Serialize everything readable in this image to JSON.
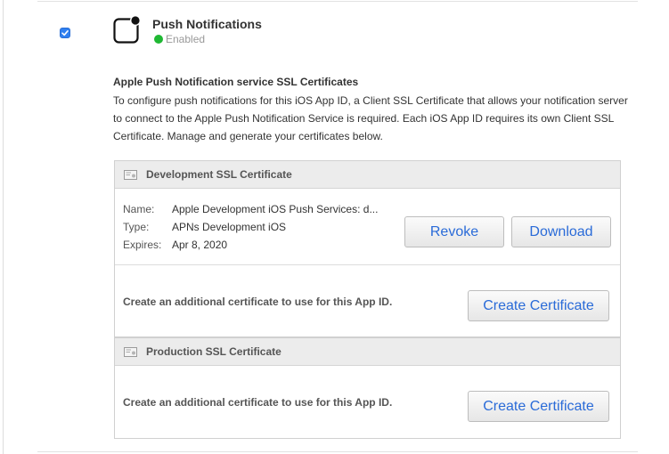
{
  "feature": {
    "checked": true,
    "title": "Push Notifications",
    "status": "Enabled"
  },
  "section": {
    "heading": "Apple Push Notification service SSL Certificates",
    "description": "To configure push notifications for this iOS App ID, a Client SSL Certificate that allows your notification server to connect to the Apple Push Notification Service is required. Each iOS App ID requires its own Client SSL Certificate. Manage and generate your certificates below."
  },
  "development": {
    "title": "Development SSL Certificate",
    "name_label": "Name:",
    "name_value": "Apple Development iOS Push Services: d...",
    "type_label": "Type:",
    "type_value": "APNs Development iOS",
    "expires_label": "Expires:",
    "expires_value": "Apr 8, 2020",
    "revoke_label": "Revoke",
    "download_label": "Download",
    "additional_text": "Create an additional certificate to use for this App ID.",
    "create_label": "Create Certificate"
  },
  "production": {
    "title": "Production SSL Certificate",
    "additional_text": "Create an additional certificate to use for this App ID.",
    "create_label": "Create Certificate"
  },
  "colors": {
    "accent": "#2a6bd8",
    "enabled_dot": "#1fb833",
    "checkbox": "#2f7ff0"
  }
}
